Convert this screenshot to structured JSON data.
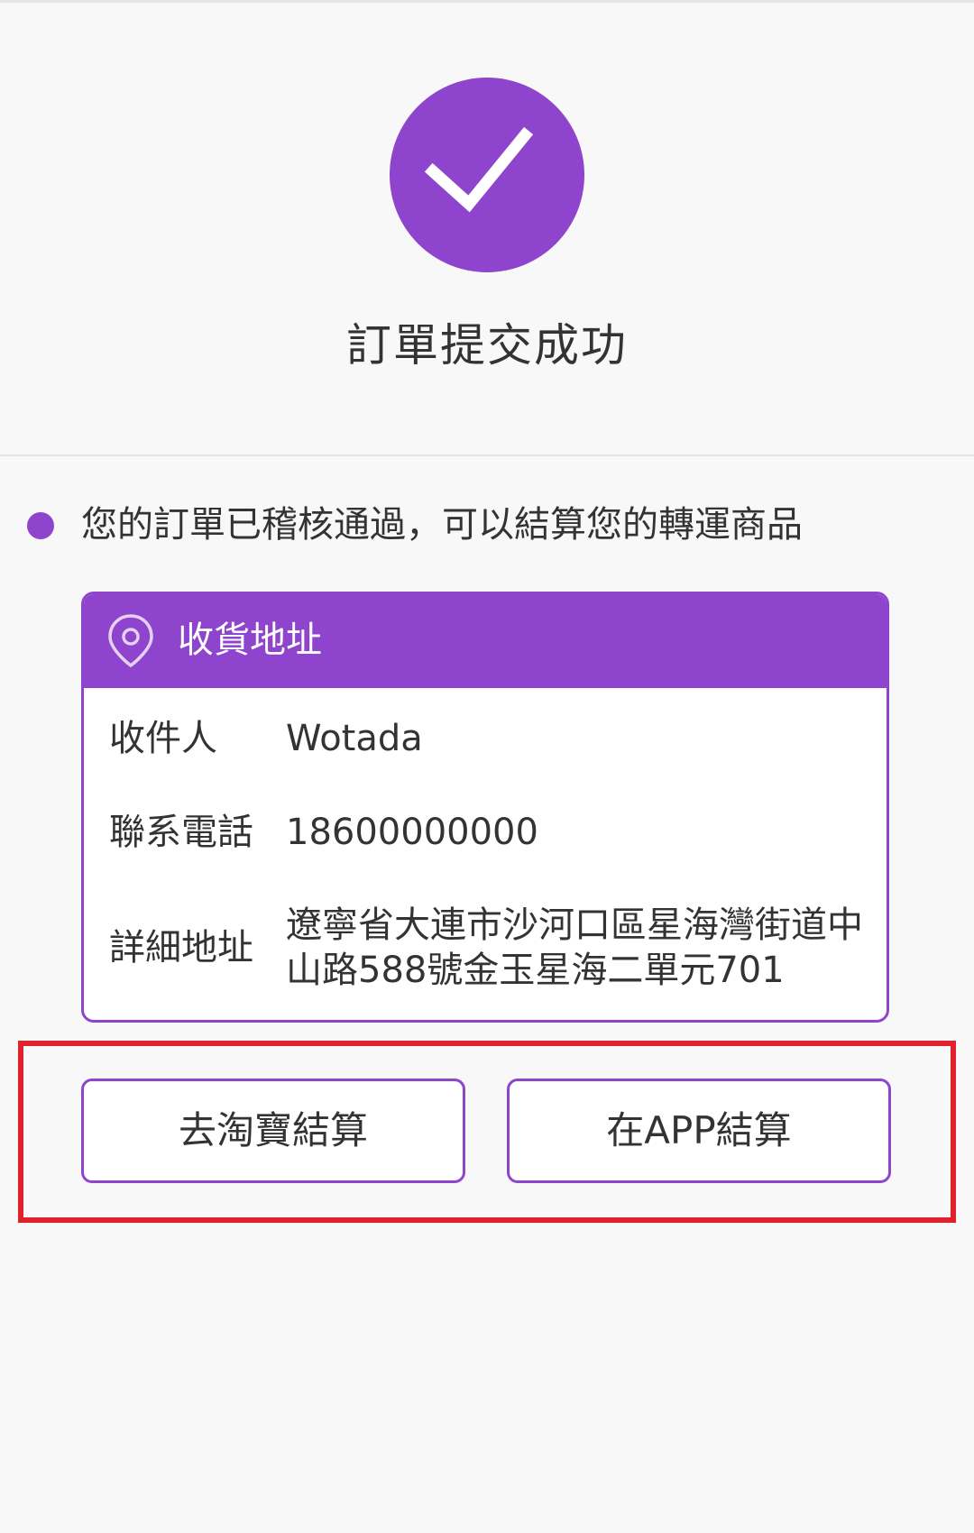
{
  "success": {
    "icon": "checkmark-icon",
    "title": "訂單提交成功"
  },
  "notice": {
    "text": "您的訂單已稽核通過，可以結算您的轉運商品"
  },
  "address_card": {
    "icon": "location-pin-icon",
    "title": "收貨地址",
    "fields": [
      {
        "label": "收件人",
        "value": "Wotada"
      },
      {
        "label": "聯系電話",
        "value": "18600000000"
      },
      {
        "label": "詳細地址",
        "value": "遼寧省大連市沙河口區星海灣街道中山路588號金玉星海二單元701"
      }
    ]
  },
  "actions": {
    "taobao_label": "去淘寶結算",
    "app_label": "在APP結算"
  },
  "colors": {
    "accent": "#8e44cc",
    "highlight": "#e0202a",
    "background": "#f8f8f8",
    "text": "#333333"
  }
}
